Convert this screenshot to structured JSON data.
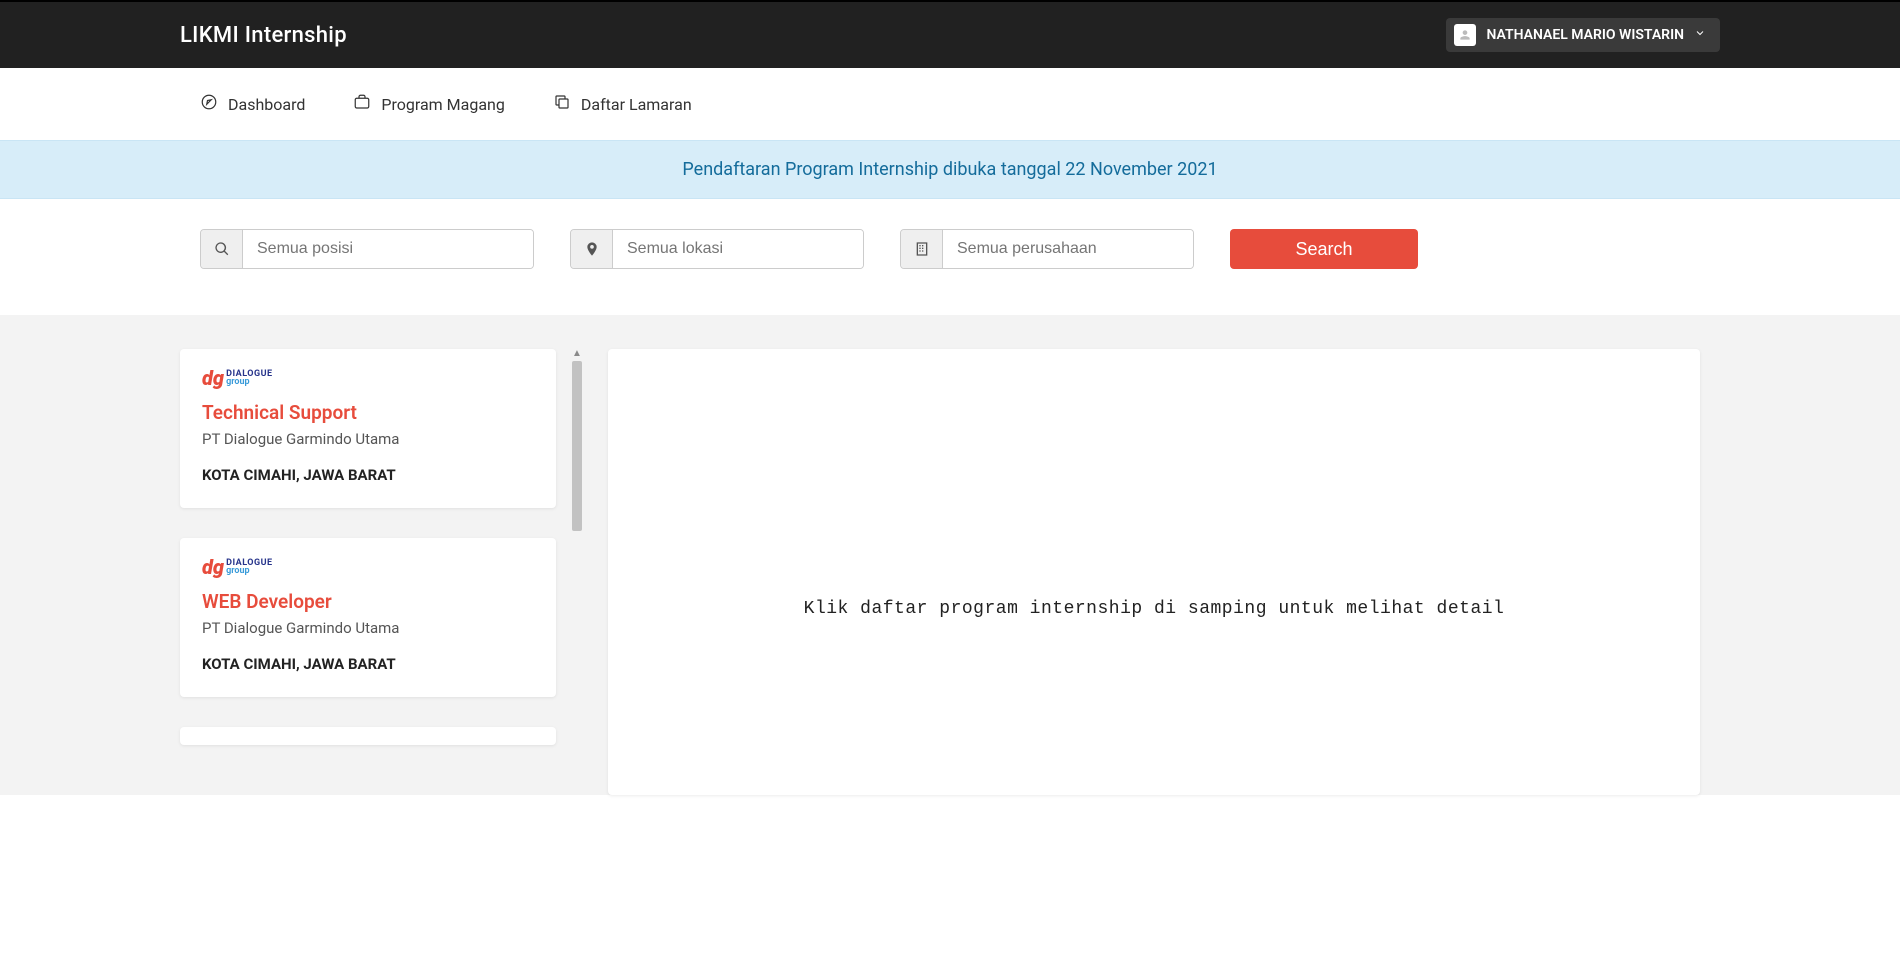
{
  "brand": "LIKMI Internship",
  "user": {
    "name": "NATHANAEL MARIO WISTARIN"
  },
  "nav": {
    "dashboard": "Dashboard",
    "program": "Program Magang",
    "lamaran": "Daftar Lamaran"
  },
  "banner": "Pendaftaran Program Internship dibuka tanggal 22 November 2021",
  "search": {
    "position_placeholder": "Semua posisi",
    "location_placeholder": "Semua lokasi",
    "company_placeholder": "Semua perusahaan",
    "button": "Search"
  },
  "listings": [
    {
      "logo_brand": "dg",
      "logo_line1": "DIALOGUE",
      "logo_line2": "group",
      "title": "Technical Support",
      "company": "PT Dialogue Garmindo Utama",
      "location": "KOTA CIMAHI, JAWA BARAT"
    },
    {
      "logo_brand": "dg",
      "logo_line1": "DIALOGUE",
      "logo_line2": "group",
      "title": "WEB Developer",
      "company": "PT Dialogue Garmindo Utama",
      "location": "KOTA CIMAHI, JAWA BARAT"
    }
  ],
  "detail_placeholder": "Klik daftar program internship di samping untuk melihat detail"
}
